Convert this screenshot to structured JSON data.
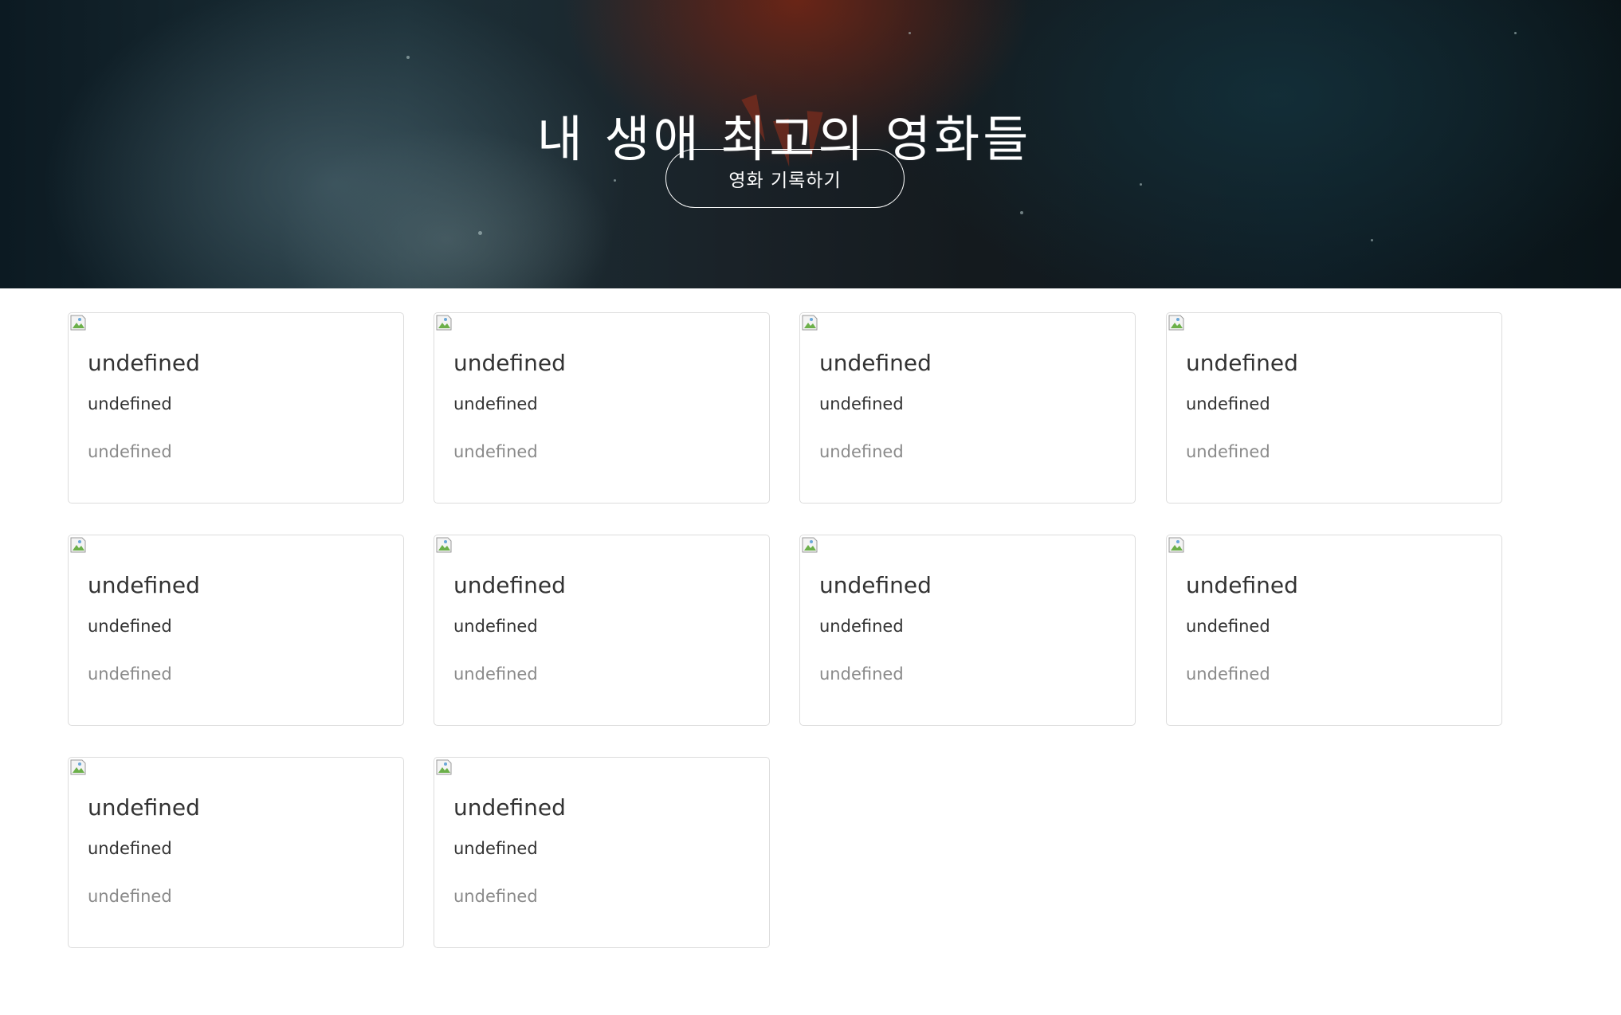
{
  "hero": {
    "title": "내 생애 최고의 영화들",
    "button_label": "영화 기록하기"
  },
  "movies": [
    {
      "title": "undefined",
      "subtitle": "undefined",
      "meta": "undefined"
    },
    {
      "title": "undefined",
      "subtitle": "undefined",
      "meta": "undefined"
    },
    {
      "title": "undefined",
      "subtitle": "undefined",
      "meta": "undefined"
    },
    {
      "title": "undefined",
      "subtitle": "undefined",
      "meta": "undefined"
    },
    {
      "title": "undefined",
      "subtitle": "undefined",
      "meta": "undefined"
    },
    {
      "title": "undefined",
      "subtitle": "undefined",
      "meta": "undefined"
    },
    {
      "title": "undefined",
      "subtitle": "undefined",
      "meta": "undefined"
    },
    {
      "title": "undefined",
      "subtitle": "undefined",
      "meta": "undefined"
    },
    {
      "title": "undefined",
      "subtitle": "undefined",
      "meta": "undefined"
    },
    {
      "title": "undefined",
      "subtitle": "undefined",
      "meta": "undefined"
    }
  ],
  "icons": {
    "broken_image": "broken-image-icon"
  },
  "colors": {
    "card_border": "#dcdcdc",
    "text_primary": "#333333",
    "text_muted": "#8a8a8a",
    "hero_text": "#ffffff"
  }
}
